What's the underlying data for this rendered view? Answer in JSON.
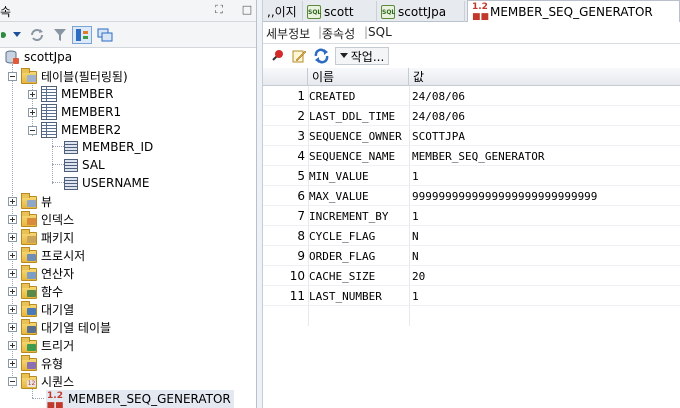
{
  "left": {
    "title_fragment": "속",
    "tree": {
      "connection": "scottJpa",
      "tables_folder": "테이블(필터링됨)",
      "tables": [
        {
          "name": "MEMBER",
          "expanded": false
        },
        {
          "name": "MEMBER1",
          "expanded": false
        },
        {
          "name": "MEMBER2",
          "expanded": true,
          "columns": [
            "MEMBER_ID",
            "SAL",
            "USERNAME"
          ]
        }
      ],
      "folders": [
        "뷰",
        "인덱스",
        "패키지",
        "프로시저",
        "연산자",
        "함수",
        "대기열",
        "대기열 테이블",
        "트리거",
        "유형",
        "시퀀스"
      ],
      "sequence_item": "MEMBER_SEQ_GENERATOR"
    }
  },
  "right": {
    "tabs": [
      {
        "label": ",,이지",
        "icon": "none"
      },
      {
        "label": "scott",
        "icon": "sql-icon"
      },
      {
        "label": "scottJpa",
        "icon": "sql-icon"
      },
      {
        "label": "MEMBER_SEQ_GENERATOR",
        "icon": "sequence-icon",
        "active": true
      }
    ],
    "subtabs": [
      "세부정보",
      "종속성",
      "SQL"
    ],
    "toolbar": {
      "actions_label": "작업..."
    },
    "grid": {
      "headers": [
        "이름",
        "값"
      ],
      "rows": [
        {
          "n": "1",
          "name": "CREATED",
          "value": "24/08/06"
        },
        {
          "n": "2",
          "name": "LAST_DDL_TIME",
          "value": "24/08/06"
        },
        {
          "n": "3",
          "name": "SEQUENCE_OWNER",
          "value": "SCOTTJPA"
        },
        {
          "n": "4",
          "name": "SEQUENCE_NAME",
          "value": "MEMBER_SEQ_GENERATOR"
        },
        {
          "n": "5",
          "name": "MIN_VALUE",
          "value": "1"
        },
        {
          "n": "6",
          "name": "MAX_VALUE",
          "value": "9999999999999999999999999999"
        },
        {
          "n": "7",
          "name": "INCREMENT_BY",
          "value": "1"
        },
        {
          "n": "8",
          "name": "CYCLE_FLAG",
          "value": "N"
        },
        {
          "n": "9",
          "name": "ORDER_FLAG",
          "value": "N"
        },
        {
          "n": "10",
          "name": "CACHE_SIZE",
          "value": "20"
        },
        {
          "n": "11",
          "name": "LAST_NUMBER",
          "value": "1"
        }
      ]
    }
  },
  "colors": {
    "selection": "#e3e8f1",
    "sequence_badge": "#c0392b",
    "sql_badge": "#2e6a1b"
  }
}
